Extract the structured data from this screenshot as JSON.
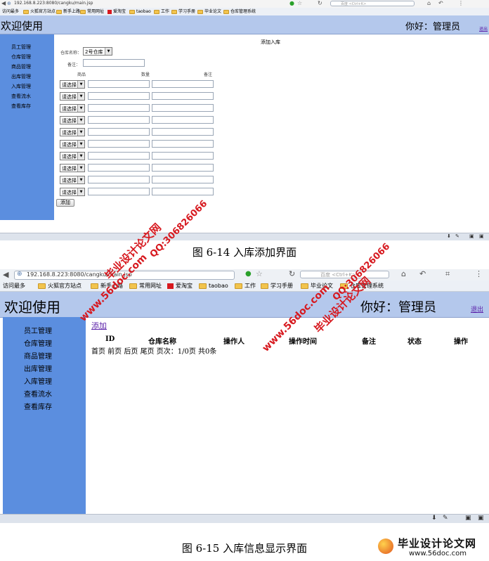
{
  "browser": {
    "url": "192.168.8.223:8080/cangku/main.jsp",
    "search_placeholder": "百度 <Ctrl+K>",
    "bookmarks": [
      "访问最多",
      "火狐官方站点",
      "新手上路",
      "常用网址",
      "爱淘宝",
      "taobao",
      "工作",
      "学习手册",
      "毕业论文",
      "仓库管理系统"
    ]
  },
  "app": {
    "title": "欢迎使用",
    "greeting": "你好：管理员",
    "logout": "退出",
    "menu": [
      "员工管理",
      "仓库管理",
      "商品管理",
      "出库管理",
      "入库管理",
      "查看流水",
      "查看库存"
    ]
  },
  "figure1": {
    "form_title": "添加入库",
    "warehouse_label": "仓库名称：",
    "warehouse_value": "2号仓库",
    "remark_label": "备注：",
    "col_goods": "商品",
    "col_qty": "数量",
    "col_remark": "备注",
    "row_select": "请选择",
    "submit": "添加",
    "caption": "图 6-14 入库添加界面"
  },
  "figure2": {
    "add_link": "添加",
    "columns": [
      "ID",
      "仓库名称",
      "操作人",
      "操作时间",
      "备注",
      "状态",
      "操作"
    ],
    "pager": [
      "首页",
      "前页",
      "后页",
      "尾页",
      "页次：1/0页",
      "共0条"
    ],
    "caption": "图 6-15 入库信息显示界面"
  },
  "watermarks": {
    "site_name": "毕业设计论文网",
    "url": "www.56doc.com",
    "qq": "QQ:306826066",
    "logo_url": "www.56doc.com"
  }
}
